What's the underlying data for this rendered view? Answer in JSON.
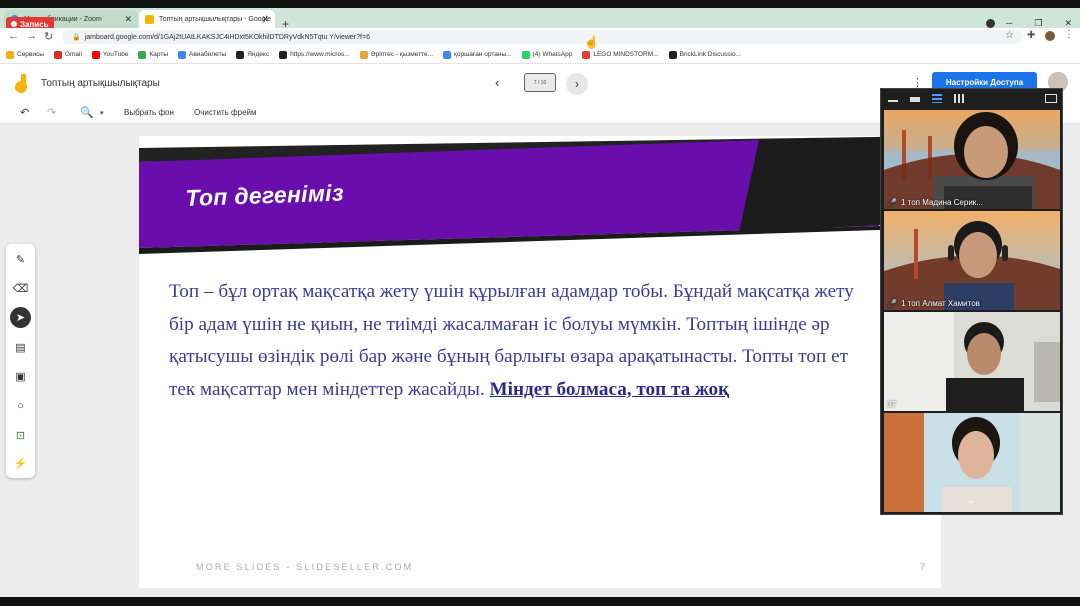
{
  "recording": {
    "label": "Запись"
  },
  "tabs": [
    {
      "title": "Мои публикации - Zoom"
    },
    {
      "title": "Топтың артықшылықтары - Google"
    }
  ],
  "address": {
    "url": "jamboard.google.com/d/1GAj2tUAtLKAKSJC4iHDxt5KOkhilDTDRyVdkN5Tqtu Y/viewer?f=6"
  },
  "bookmarks": [
    {
      "label": "Сервисы",
      "color": "#f2b01e"
    },
    {
      "label": "Gmail",
      "color": "#d93025"
    },
    {
      "label": "YouTube",
      "color": "#ff0000"
    },
    {
      "label": "Карты",
      "color": "#34a853"
    },
    {
      "label": "Авиабилеты",
      "color": "#4285f4"
    },
    {
      "label": "Яндекс",
      "color": "#222222"
    },
    {
      "label": "https://www.micros...",
      "color": "#222222"
    },
    {
      "label": "Әріптес - қызметте...",
      "color": "#e8a33d"
    },
    {
      "label": "қоршаған ортаны...",
      "color": "#4285f4"
    },
    {
      "label": "(4) WhatsApp",
      "color": "#25d366"
    },
    {
      "label": "LEGO MINDSTORM...",
      "color": "#e53935"
    },
    {
      "label": "BrickLink Discussio...",
      "color": "#222222"
    }
  ],
  "jamboard": {
    "title": "Топтың артықшылықтары",
    "frame_indicator": "7 / 10",
    "share_button": "Настройки Доступа"
  },
  "toolbar": {
    "set_background": "Выбрать фон",
    "clear_frame": "Очистить фрейм"
  },
  "slide": {
    "title": "Топ дегеніміз",
    "body_lines": [
      "Топ – бұл ортақ мақсатқа жету үшін құрылған адамдар тобы. Бұндай мақсатқа жету",
      "бір адам үшін не қиын, не тиімді жасалмаған іс болуы мүмкін. Топтың ішінде әр",
      "қатысушы өзіндік рөлі бар және бұның барлығы өзара арақатынасты. Топты топ ет",
      "тек мақсаттар мен міндеттер жасайды. "
    ],
    "emphasis": "Міндет болмаса, топ та жоқ",
    "footer": "MORE SLIDES - SLIDESELLER.COM",
    "page_number": "7",
    "accent_color": "#6a0dad"
  },
  "participants": [
    {
      "name": "1 топ Мадина Серик...",
      "muted": true
    },
    {
      "name": "1 топ Алмат Хамитов",
      "muted": true
    },
    {
      "name": "37",
      "muted": false
    },
    {
      "name": "",
      "muted": false
    }
  ]
}
